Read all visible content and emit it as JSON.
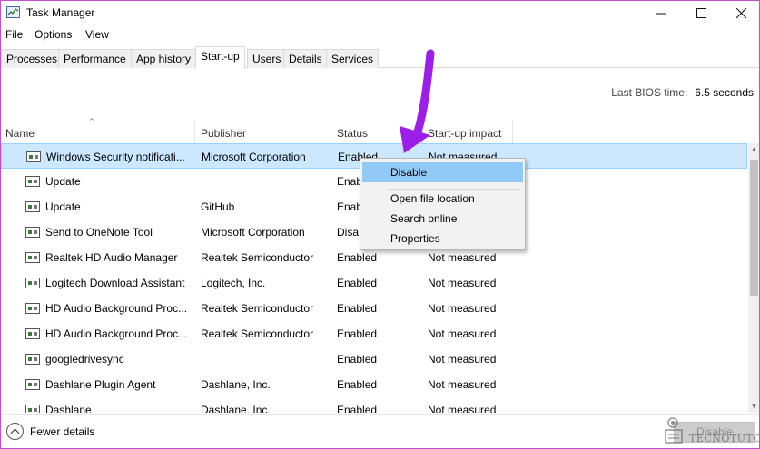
{
  "window": {
    "title": "Task Manager"
  },
  "menu": [
    "File",
    "Options",
    "View"
  ],
  "tabs": [
    {
      "label": "Processes",
      "active": false
    },
    {
      "label": "Performance",
      "active": false
    },
    {
      "label": "App history",
      "active": false
    },
    {
      "label": "Start-up",
      "active": true
    },
    {
      "label": "Users",
      "active": false
    },
    {
      "label": "Details",
      "active": false
    },
    {
      "label": "Services",
      "active": false
    }
  ],
  "bios": {
    "label": "Last BIOS time:",
    "value": "6.5 seconds"
  },
  "columns": {
    "name": "Name",
    "publisher": "Publisher",
    "status": "Status",
    "impact": "Start-up impact"
  },
  "rows": [
    {
      "name": "Windows Security notificati...",
      "publisher": "Microsoft Corporation",
      "status": "Enabled",
      "impact": "Not measured"
    },
    {
      "name": "Update",
      "publisher": "",
      "status": "Enab",
      "impact": ""
    },
    {
      "name": "Update",
      "publisher": "GitHub",
      "status": "Enab",
      "impact": ""
    },
    {
      "name": "Send to OneNote Tool",
      "publisher": "Microsoft Corporation",
      "status": "Disa",
      "impact": ""
    },
    {
      "name": "Realtek HD Audio Manager",
      "publisher": "Realtek Semiconductor",
      "status": "Enabled",
      "impact": "Not measured"
    },
    {
      "name": "Logitech Download Assistant",
      "publisher": "Logitech, Inc.",
      "status": "Enabled",
      "impact": "Not measured"
    },
    {
      "name": "HD Audio Background Proc...",
      "publisher": "Realtek Semiconductor",
      "status": "Enabled",
      "impact": "Not measured"
    },
    {
      "name": "HD Audio Background Proc...",
      "publisher": "Realtek Semiconductor",
      "status": "Enabled",
      "impact": "Not measured"
    },
    {
      "name": "googledrivesync",
      "publisher": "",
      "status": "Enabled",
      "impact": "Not measured"
    },
    {
      "name": "Dashlane Plugin Agent",
      "publisher": "Dashlane, Inc.",
      "status": "Enabled",
      "impact": "Not measured"
    },
    {
      "name": "Dashlane",
      "publisher": "Dashlane, Inc.",
      "status": "Enabled",
      "impact": "Not measured"
    }
  ],
  "context_menu": {
    "items": [
      "Disable",
      "Open file location",
      "Search online",
      "Properties"
    ],
    "highlighted": "Disable"
  },
  "footer": {
    "fewer_details": "Fewer details",
    "disable_button": "Disable"
  },
  "watermark": {
    "text": "TECNOTUTO"
  },
  "colors": {
    "selection": "#cce8ff",
    "menu_highlight": "#91c9f7",
    "arrow": "#9b1fe8",
    "window_border": "#c24fd0"
  },
  "icons": {
    "app": "task-manager-icon",
    "row": "startup-app-icon",
    "fewer": "chevron-up-icon",
    "annotation": "arrow-annotation"
  }
}
